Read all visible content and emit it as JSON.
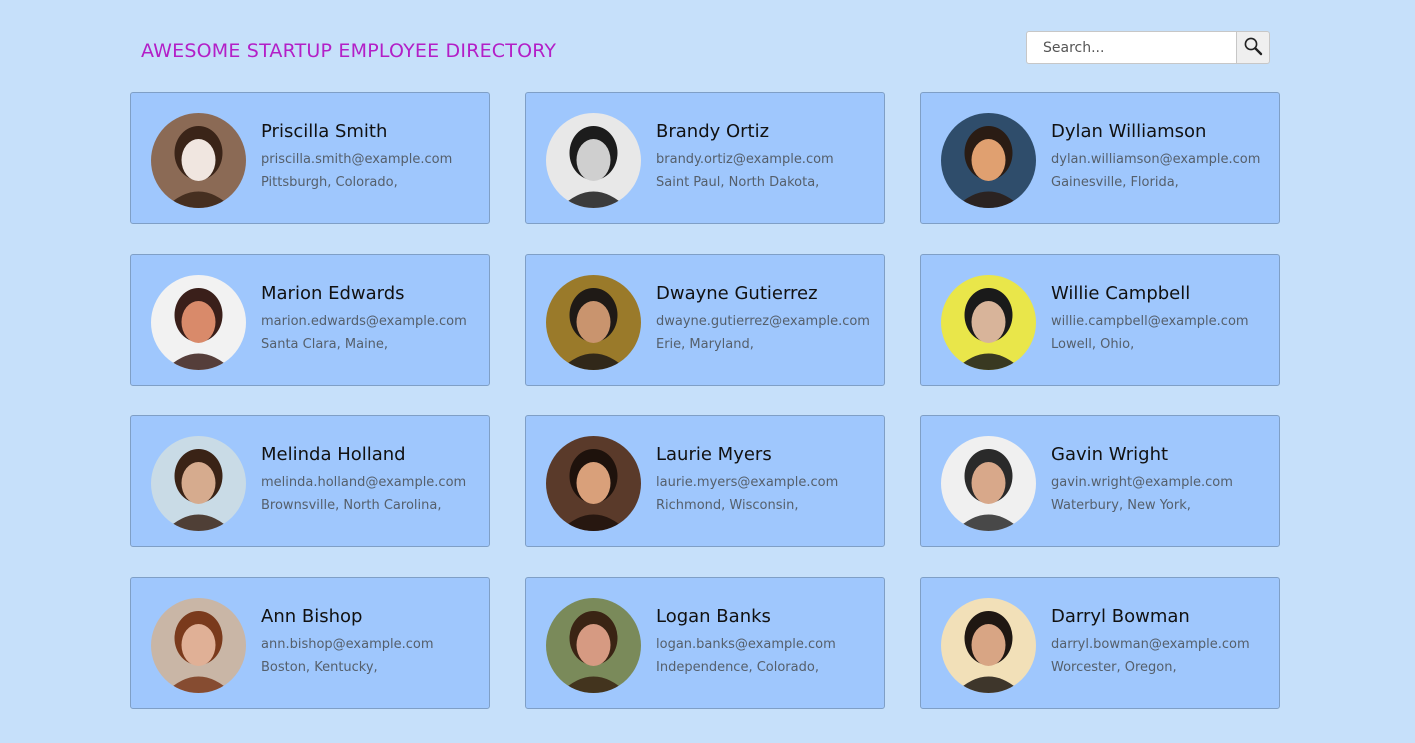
{
  "header": {
    "title": "AWESOME STARTUP EMPLOYEE DIRECTORY",
    "title_color": "#b31fc7"
  },
  "search": {
    "placeholder": "Search...",
    "value": "",
    "button_icon": "search-icon"
  },
  "employees": [
    {
      "name": "Priscilla Smith",
      "email": "priscilla.smith@example.com",
      "location": "Pittsburgh, Colorado,",
      "photo_colors": [
        "#8b6a55",
        "#f0e6e0",
        "#3a2418"
      ]
    },
    {
      "name": "Brandy Ortiz",
      "email": "brandy.ortiz@example.com",
      "location": "Saint Paul, North Dakota,",
      "photo_colors": [
        "#e8e8e8",
        "#cfcfcf",
        "#1c1c1c"
      ]
    },
    {
      "name": "Dylan Williamson",
      "email": "dylan.williamson@example.com",
      "location": "Gainesville, Florida,",
      "photo_colors": [
        "#2f4d6b",
        "#e0a070",
        "#2a1c14"
      ]
    },
    {
      "name": "Marion Edwards",
      "email": "marion.edwards@example.com",
      "location": "Santa Clara, Maine,",
      "photo_colors": [
        "#f2f2f2",
        "#d98a6a",
        "#3a1f1a"
      ]
    },
    {
      "name": "Dwayne Gutierrez",
      "email": "dwayne.gutierrez@example.com",
      "location": "Erie, Maryland,",
      "photo_colors": [
        "#9a7a2a",
        "#c9946e",
        "#1f1a16"
      ]
    },
    {
      "name": "Willie Campbell",
      "email": "willie.campbell@example.com",
      "location": "Lowell, Ohio,",
      "photo_colors": [
        "#e9e64a",
        "#d8b49a",
        "#1a1a1a"
      ]
    },
    {
      "name": "Melinda Holland",
      "email": "melinda.holland@example.com",
      "location": "Brownsville, North Carolina,",
      "photo_colors": [
        "#c9dbe6",
        "#d6ab8e",
        "#3a2316"
      ]
    },
    {
      "name": "Laurie Myers",
      "email": "laurie.myers@example.com",
      "location": "Richmond, Wisconsin,",
      "photo_colors": [
        "#5a3a2a",
        "#d9a07a",
        "#1e120c"
      ]
    },
    {
      "name": "Gavin Wright",
      "email": "gavin.wright@example.com",
      "location": "Waterbury, New York,",
      "photo_colors": [
        "#f0f0f0",
        "#d8a88a",
        "#2a2a2a"
      ]
    },
    {
      "name": "Ann Bishop",
      "email": "ann.bishop@example.com",
      "location": "Boston, Kentucky,",
      "photo_colors": [
        "#c9b6a6",
        "#e0b096",
        "#7a3a1c"
      ]
    },
    {
      "name": "Logan Banks",
      "email": "logan.banks@example.com",
      "location": "Independence, Colorado,",
      "photo_colors": [
        "#7a8a5a",
        "#d69a82",
        "#3a2414"
      ]
    },
    {
      "name": "Darryl Bowman",
      "email": "darryl.bowman@example.com",
      "location": "Worcester, Oregon,",
      "photo_colors": [
        "#f2e0b8",
        "#d8a584",
        "#1f1712"
      ]
    }
  ]
}
